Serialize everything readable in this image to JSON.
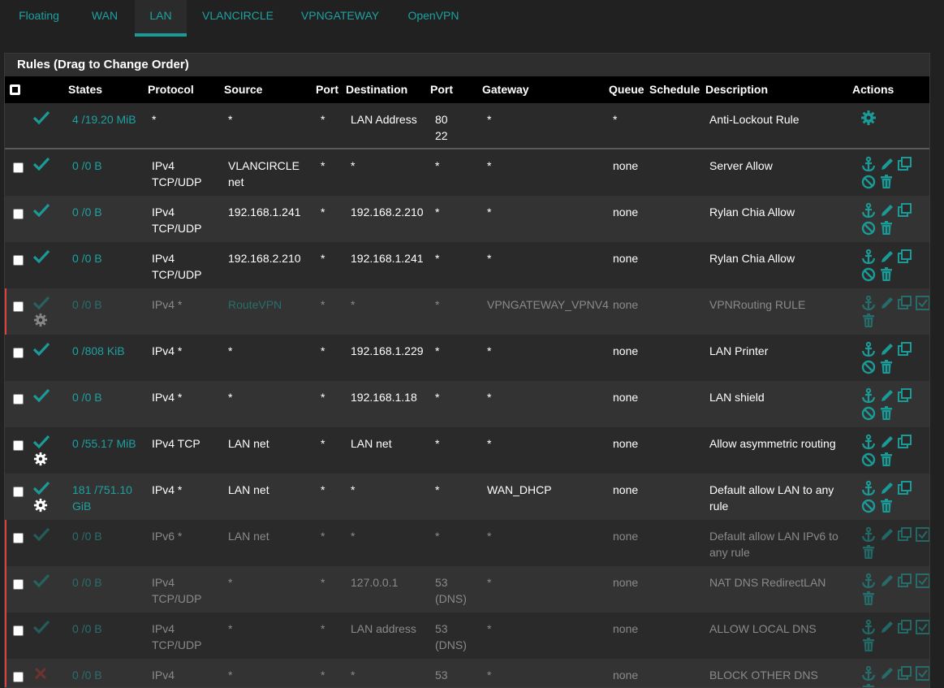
{
  "tabs": [
    {
      "label": "Floating",
      "active": false
    },
    {
      "label": "WAN",
      "active": false
    },
    {
      "label": "LAN",
      "active": true
    },
    {
      "label": "VLANCIRCLE",
      "active": false
    },
    {
      "label": "VPNGATEWAY",
      "active": false
    },
    {
      "label": "OpenVPN",
      "active": false
    }
  ],
  "panel_title": "Rules (Drag to Change Order)",
  "columns": {
    "states": "States",
    "protocol": "Protocol",
    "source": "Source",
    "port": "Port",
    "destination": "Destination",
    "dport": "Port",
    "gateway": "Gateway",
    "queue": "Queue",
    "schedule": "Schedule",
    "description": "Description",
    "actions": "Actions"
  },
  "colors": {
    "accent": "#1a9b97",
    "green": "#1ea1a1",
    "disabled_bar": "#e04040",
    "block": "#e04040"
  },
  "rules": [
    {
      "status": "pass",
      "gear": false,
      "disabled": false,
      "lock": true,
      "states": "4 /19.20 MiB",
      "protocol": "*",
      "source": "*",
      "port": "*",
      "destination": "LAN Address",
      "dport": "80\n22",
      "gateway": "*",
      "queue": "*",
      "schedule": "",
      "description": "Anti-Lockout Rule"
    },
    {
      "status": "pass",
      "gear": false,
      "disabled": false,
      "states": "0 /0 B",
      "protocol": "IPv4\nTCP/UDP",
      "source": "VLANCIRCLE\nnet",
      "port": "*",
      "destination": "*",
      "dport": "*",
      "gateway": "*",
      "queue": "none",
      "schedule": "",
      "description": "Server Allow"
    },
    {
      "status": "pass",
      "gear": false,
      "disabled": false,
      "states": "0 /0 B",
      "protocol": "IPv4\nTCP/UDP",
      "source": "192.168.1.241",
      "port": "*",
      "destination": "192.168.2.210",
      "dport": "*",
      "gateway": "*",
      "queue": "none",
      "schedule": "",
      "description": "Rylan Chia Allow"
    },
    {
      "status": "pass",
      "gear": false,
      "disabled": false,
      "states": "0 /0 B",
      "protocol": "IPv4\nTCP/UDP",
      "source": "192.168.2.210",
      "port": "*",
      "destination": "192.168.1.241",
      "dport": "*",
      "gateway": "*",
      "queue": "none",
      "schedule": "",
      "description": "Rylan Chia Allow"
    },
    {
      "status": "pass",
      "gear": true,
      "disabled": true,
      "states": "0 /0 B",
      "protocol": "IPv4 *",
      "source": "RouteVPN",
      "port": "*",
      "destination": "*",
      "dport": "*",
      "gateway": "VPNGATEWAY_VPNV4",
      "queue": "none",
      "schedule": "",
      "description": "VPNRouting RULE"
    },
    {
      "status": "pass",
      "gear": false,
      "disabled": false,
      "states": "0 /808 KiB",
      "protocol": "IPv4 *",
      "source": "*",
      "port": "*",
      "destination": "192.168.1.229",
      "dport": "*",
      "gateway": "*",
      "queue": "none",
      "schedule": "",
      "description": "LAN Printer"
    },
    {
      "status": "pass",
      "gear": false,
      "disabled": false,
      "states": "0 /0 B",
      "protocol": "IPv4 *",
      "source": "*",
      "port": "*",
      "destination": "192.168.1.18",
      "dport": "*",
      "gateway": "*",
      "queue": "none",
      "schedule": "",
      "description": "LAN shield"
    },
    {
      "status": "pass",
      "gear": true,
      "disabled": false,
      "states": "0 /55.17 MiB",
      "protocol": "IPv4 TCP",
      "source": "LAN net",
      "port": "*",
      "destination": "LAN net",
      "dport": "*",
      "gateway": "*",
      "queue": "none",
      "schedule": "",
      "description": "Allow asymmetric routing"
    },
    {
      "status": "pass",
      "gear": true,
      "disabled": false,
      "states": "181 /751.10\nGiB",
      "protocol": "IPv4 *",
      "source": "LAN net",
      "port": "*",
      "destination": "*",
      "dport": "*",
      "gateway": "WAN_DHCP",
      "queue": "none",
      "schedule": "",
      "description": "Default allow LAN to any\nrule"
    },
    {
      "status": "pass",
      "gear": false,
      "disabled": true,
      "states": "0 /0 B",
      "protocol": "IPv6 *",
      "source": "LAN net",
      "port": "*",
      "destination": "*",
      "dport": "*",
      "gateway": "*",
      "queue": "none",
      "schedule": "",
      "description": "Default allow LAN IPv6 to\nany rule"
    },
    {
      "status": "pass",
      "gear": false,
      "disabled": true,
      "states": "0 /0 B",
      "protocol": "IPv4\nTCP/UDP",
      "source": "*",
      "port": "*",
      "destination": "127.0.0.1",
      "dport": "53\n(DNS)",
      "gateway": "*",
      "queue": "none",
      "schedule": "",
      "description": "NAT DNS RedirectLAN"
    },
    {
      "status": "pass",
      "gear": false,
      "disabled": true,
      "states": "0 /0 B",
      "protocol": "IPv4\nTCP/UDP",
      "source": "*",
      "port": "*",
      "destination": "LAN address",
      "dport": "53\n(DNS)",
      "gateway": "*",
      "queue": "none",
      "schedule": "",
      "description": "ALLOW LOCAL DNS"
    },
    {
      "status": "block",
      "gear": false,
      "disabled": true,
      "states": "0 /0 B",
      "protocol": "IPv4",
      "source": "*",
      "port": "*",
      "destination": "*",
      "dport": "53",
      "gateway": "*",
      "queue": "none",
      "schedule": "",
      "description": "BLOCK OTHER DNS"
    }
  ]
}
